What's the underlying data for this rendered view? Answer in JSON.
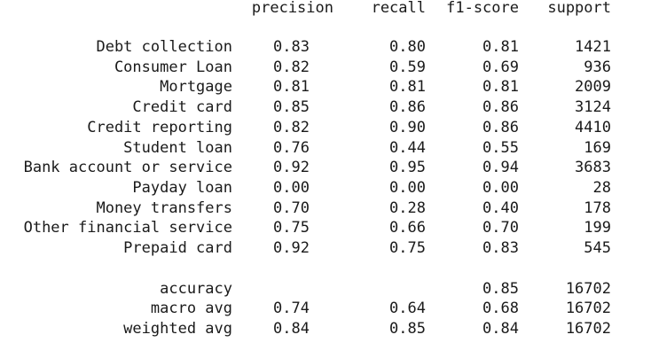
{
  "report": {
    "headers": {
      "precision": "precision",
      "recall": "recall",
      "f1": "f1-score",
      "support": "support"
    },
    "classes": [
      {
        "label": "Debt collection",
        "precision": "0.83",
        "recall": "0.80",
        "f1": "0.81",
        "support": "1421"
      },
      {
        "label": "Consumer Loan",
        "precision": "0.82",
        "recall": "0.59",
        "f1": "0.69",
        "support": "936"
      },
      {
        "label": "Mortgage",
        "precision": "0.81",
        "recall": "0.81",
        "f1": "0.81",
        "support": "2009"
      },
      {
        "label": "Credit card",
        "precision": "0.85",
        "recall": "0.86",
        "f1": "0.86",
        "support": "3124"
      },
      {
        "label": "Credit reporting",
        "precision": "0.82",
        "recall": "0.90",
        "f1": "0.86",
        "support": "4410"
      },
      {
        "label": "Student loan",
        "precision": "0.76",
        "recall": "0.44",
        "f1": "0.55",
        "support": "169"
      },
      {
        "label": "Bank account or service",
        "precision": "0.92",
        "recall": "0.95",
        "f1": "0.94",
        "support": "3683"
      },
      {
        "label": "Payday loan",
        "precision": "0.00",
        "recall": "0.00",
        "f1": "0.00",
        "support": "28"
      },
      {
        "label": "Money transfers",
        "precision": "0.70",
        "recall": "0.28",
        "f1": "0.40",
        "support": "178"
      },
      {
        "label": "Other financial service",
        "precision": "0.75",
        "recall": "0.66",
        "f1": "0.70",
        "support": "199"
      },
      {
        "label": "Prepaid card",
        "precision": "0.92",
        "recall": "0.75",
        "f1": "0.83",
        "support": "545"
      }
    ],
    "summary": {
      "accuracy": {
        "label": "accuracy",
        "f1": "0.85",
        "support": "16702"
      },
      "macro": {
        "label": "macro avg",
        "precision": "0.74",
        "recall": "0.64",
        "f1": "0.68",
        "support": "16702"
      },
      "weighted": {
        "label": "weighted avg",
        "precision": "0.84",
        "recall": "0.85",
        "f1": "0.84",
        "support": "16702"
      }
    }
  }
}
